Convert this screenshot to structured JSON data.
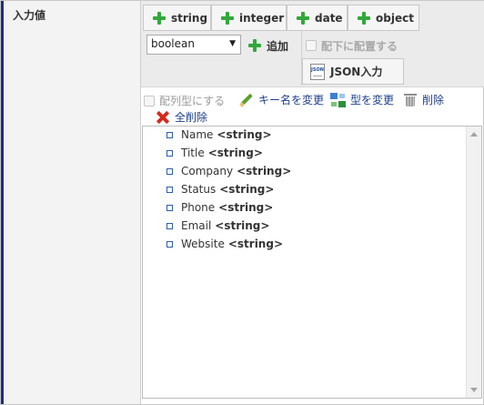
{
  "label": "入力値",
  "type_buttons": [
    {
      "label": "string"
    },
    {
      "label": "integer"
    },
    {
      "label": "date"
    },
    {
      "label": "object"
    }
  ],
  "type_select": {
    "value": "boolean"
  },
  "add_label": "追加",
  "place_under_label": "配下に配置する",
  "json_input_label": "JSON入力",
  "json_icon_text": "JSON",
  "actions": {
    "array_label": "配列型にする",
    "rename_label": "キー名を変更",
    "change_type_label": "型を変更",
    "delete_label": "削除",
    "delete_all_label": "全削除"
  },
  "tree_items": [
    {
      "key": "Name",
      "type": "<string>"
    },
    {
      "key": "Title",
      "type": "<string>"
    },
    {
      "key": "Company",
      "type": "<string>"
    },
    {
      "key": "Status",
      "type": "<string>"
    },
    {
      "key": "Phone",
      "type": "<string>"
    },
    {
      "key": "Email",
      "type": "<string>"
    },
    {
      "key": "Website",
      "type": "<string>"
    }
  ]
}
